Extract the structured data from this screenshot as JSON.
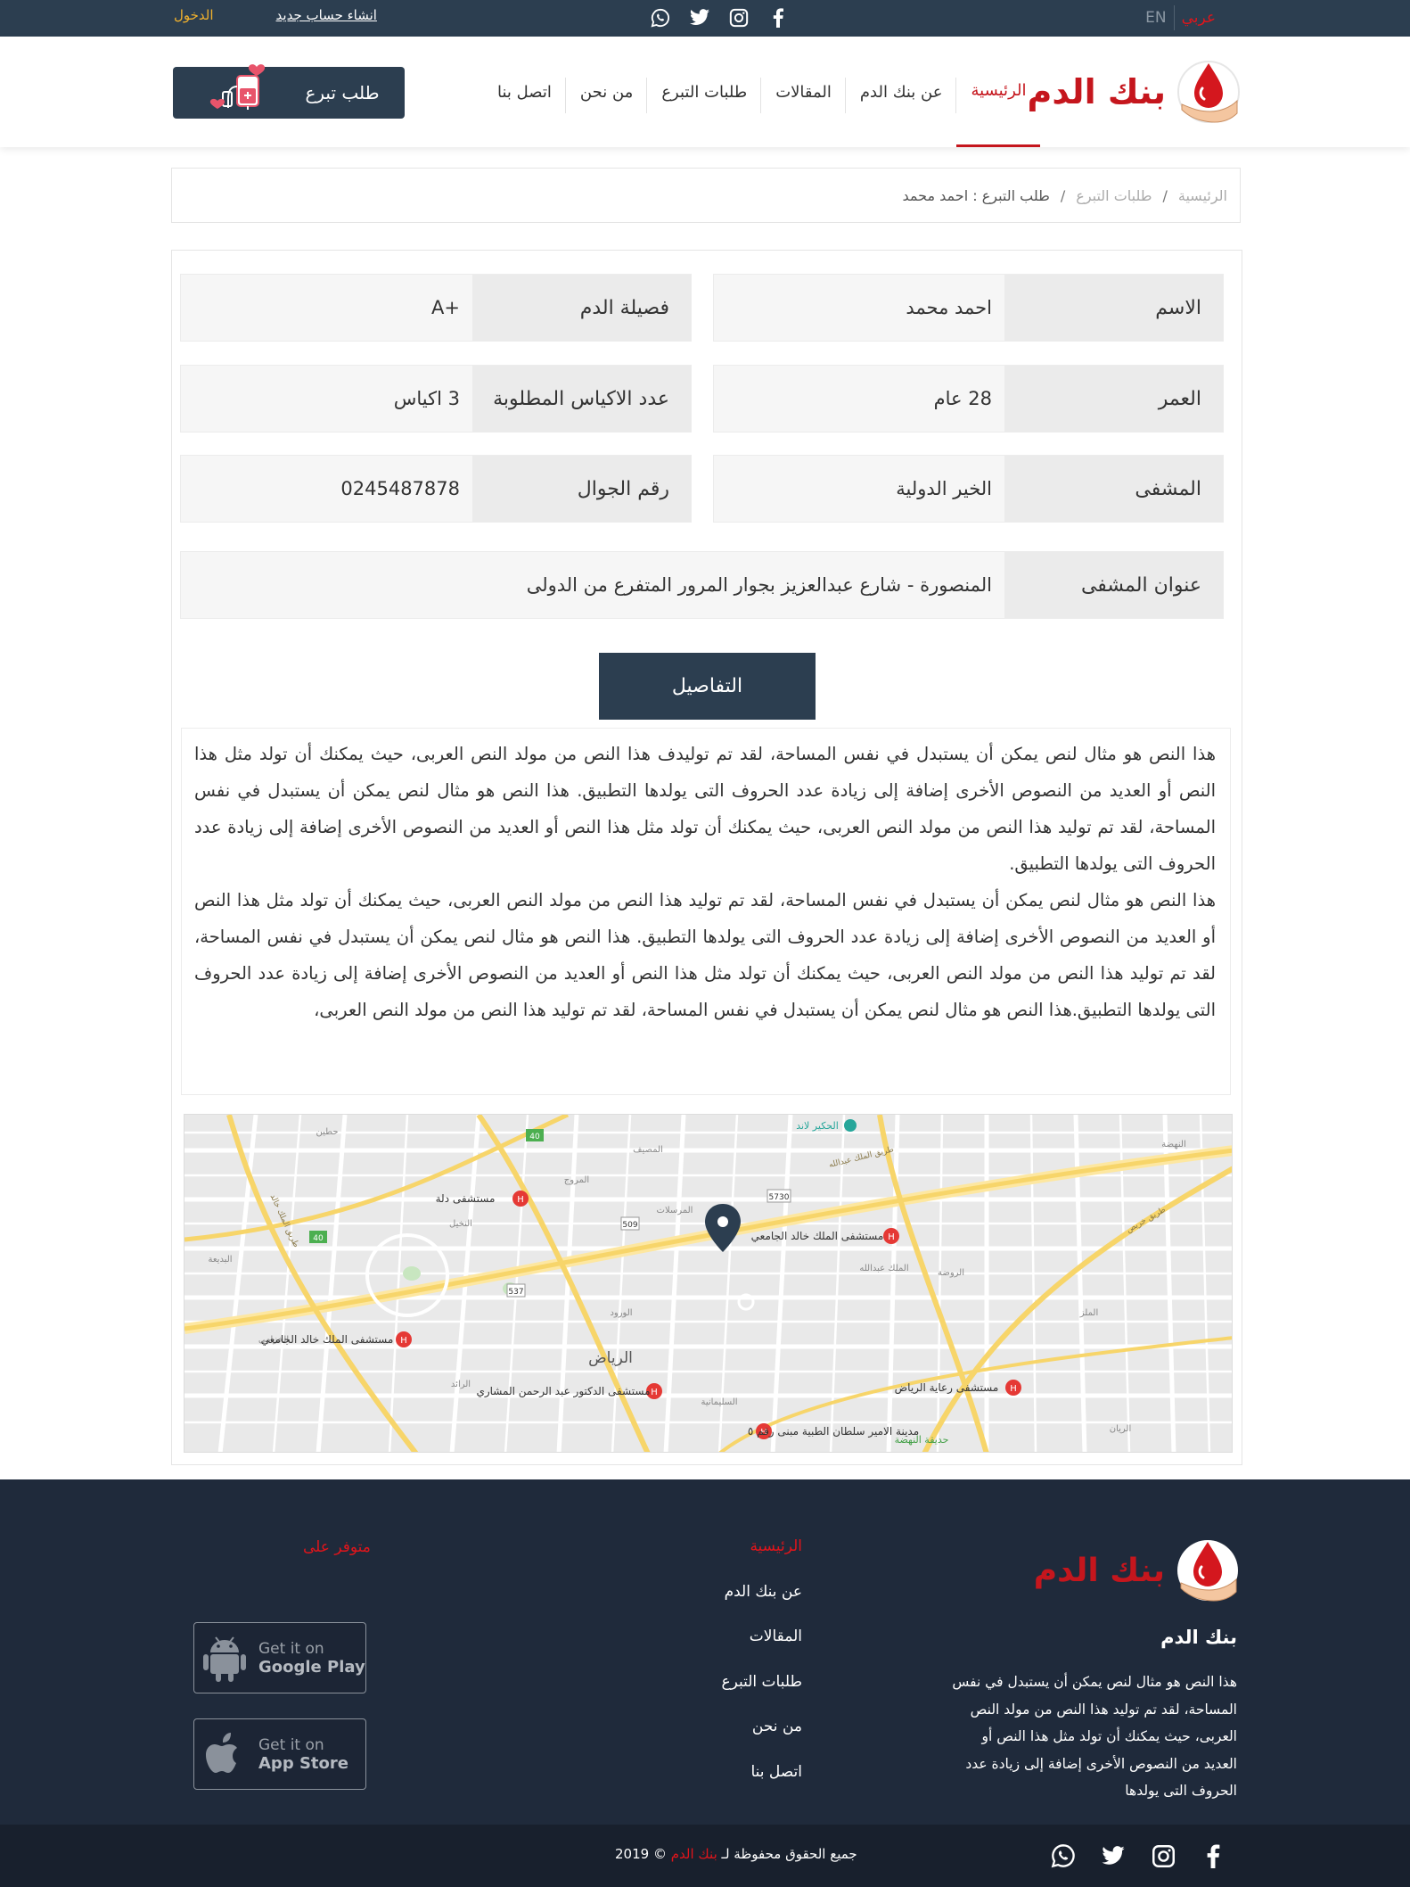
{
  "topbar": {
    "lang_ar": "عربي",
    "lang_en": "EN",
    "login": "الدخول",
    "register": "انشاء حساب جديد",
    "socials": [
      "facebook-icon",
      "instagram-icon",
      "twitter-icon",
      "whatsapp-icon"
    ]
  },
  "header": {
    "logo_text": "بنك الدم",
    "nav": [
      "الرئيسية",
      "عن بنك الدم",
      "المقالات",
      "طلبات التبرع",
      "من نحن",
      "اتصل بنا"
    ],
    "active_nav": "الرئيسية",
    "donate_button": "طلب تبرع"
  },
  "breadcrumb": {
    "home": "الرئيسية",
    "requests": "طلبات التبرع",
    "current": "طلب التبرع : احمد محمد",
    "separator": "/"
  },
  "request": {
    "name_label": "الاسم",
    "name_value": "احمد محمد",
    "blood_label": "فصيلة الدم",
    "blood_value": "A+",
    "age_label": "العمر",
    "age_value": "28 عام",
    "bags_label": "عدد الاكياس المطلوبة",
    "bags_value": "3 اكياس",
    "hospital_label": "المشفى",
    "hospital_value": "الخير الدولية",
    "phone_label": "رقم الجوال",
    "phone_value": "0245487878",
    "address_label": "عنوان المشفى",
    "address_value": "المنصورة - شارع عبدالعزيز بجوار المرور المتفرع من الدولى"
  },
  "details": {
    "button": "التفاصيل",
    "paragraph1": "هذا النص هو مثال لنص يمكن أن يستبدل في نفس المساحة، لقد تم توليدف هذا النص من مولد النص العربى، حيث يمكنك أن تولد مثل هذا النص أو العديد من النصوص الأخرى إضافة إلى زيادة عدد الحروف التى يولدها التطبيق. هذا النص هو مثال لنص يمكن أن يستبدل في نفس المساحة، لقد تم توليد هذا النص من مولد النص العربى، حيث يمكنك أن تولد مثل هذا النص أو العديد من النصوص الأخرى إضافة إلى زيادة عدد الحروف التى يولدها التطبيق.",
    "paragraph2": "هذا النص هو مثال لنص يمكن أن يستبدل في نفس المساحة، لقد تم توليد هذا النص من مولد النص العربى، حيث يمكنك أن تولد مثل هذا النص أو العديد من النصوص الأخرى إضافة إلى زيادة عدد الحروف التى يولدها التطبيق. هذا النص هو مثال لنص يمكن أن يستبدل في نفس المساحة، لقد تم توليد هذا النص من مولد النص العربى، حيث يمكنك أن تولد مثل هذا النص أو العديد من النصوص الأخرى إضافة إلى زيادة عدد الحروف التى يولدها التطبيق.هذا النص هو مثال لنص يمكن أن يستبدل في نفس المساحة، لقد تم توليد هذا النص من مولد النص العربى،"
  },
  "map": {
    "city": "الرياض",
    "places": [
      {
        "name": "مستشفى دلة"
      },
      {
        "name": "مستشفى الملك خالد الجامعي"
      },
      {
        "name": "مستشفى الملك خالد الجامعي"
      },
      {
        "name": "مستشفى الدكتور عبد الرحمن المشاري"
      },
      {
        "name": "مدينة الامير سلطان الطبية مبنى رقم ٥"
      },
      {
        "name": "مستشفى رعاية الرياض"
      },
      {
        "name": "الحكير لاند"
      },
      {
        "name": "حديقة النهضة"
      }
    ],
    "roads": [
      "طريق الملك عبدالله",
      "طريق الملك خالد",
      "طريق خريص"
    ],
    "shields": [
      "40",
      "40",
      "509",
      "537",
      "5730"
    ],
    "districts": [
      "حطين",
      "المصيف",
      "المروج",
      "المرسلات",
      "النخيل",
      "الورود",
      "النهضة",
      "الروضة",
      "الملك عبدالله",
      "السليمانية",
      "الملز",
      "البديعة",
      "الرائد",
      "الخزامى",
      "الريان"
    ]
  },
  "footer": {
    "logo_text": "بنك الدم",
    "about_title": "بنك الدم",
    "about_text": "هذا النص هو مثال لنص يمكن أن يستبدل في نفس المساحة، لقد تم توليد هذا النص من مولد النص العربى، حيث يمكنك أن تولد مثل هذا النص أو العديد من النصوص الأخرى إضافة إلى زيادة عدد الحروف التى يولدها",
    "links": [
      "الرئيسية",
      "عن بنك الدم",
      "المقالات",
      "طلبات التبرع",
      "من نحن",
      "اتصل بنا"
    ],
    "available_on": "متوفر على",
    "google_play_line1": "Get it on",
    "google_play_line2": "Google Play",
    "app_store_line1": "Get it on",
    "app_store_line2": "App Store",
    "copyright_prefix": "جميع الحقوق محفوظة لـ",
    "copyright_brand": "بنك الدم",
    "copyright_year": "2019",
    "copyright_symbol": "©"
  },
  "colors": {
    "brand_red": "#c5161d",
    "dark_navy": "#2c3e50",
    "footer_bg": "#1f2a3b",
    "gold": "#f1b12d"
  }
}
